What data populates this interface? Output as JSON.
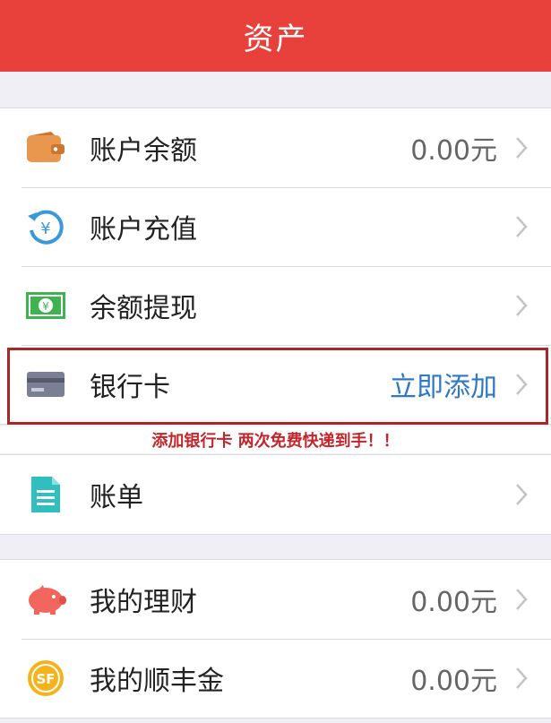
{
  "header": {
    "title": "资产"
  },
  "colors": {
    "accent": "#e8403b",
    "link": "#2e78c6",
    "highlight": "#a8282a"
  },
  "groups": [
    {
      "items": [
        {
          "label": "账户余额",
          "value": "0.00元",
          "icon": "wallet-icon"
        },
        {
          "label": "账户充值",
          "value": "",
          "icon": "recharge-icon"
        },
        {
          "label": "余额提现",
          "value": "",
          "icon": "cash-withdraw-icon"
        },
        {
          "label": "银行卡",
          "value": "立即添加",
          "icon": "bank-card-icon"
        }
      ]
    },
    {
      "items": [
        {
          "label": "账单",
          "value": "",
          "icon": "bill-icon"
        }
      ]
    },
    {
      "items": [
        {
          "label": "我的理财",
          "value": "0.00元",
          "icon": "piggy-bank-icon"
        },
        {
          "label": "我的顺丰金",
          "value": "0.00元",
          "icon": "sf-coin-icon"
        }
      ]
    }
  ],
  "promo": {
    "text": "添加银行卡  两次免费快递到手！！"
  }
}
